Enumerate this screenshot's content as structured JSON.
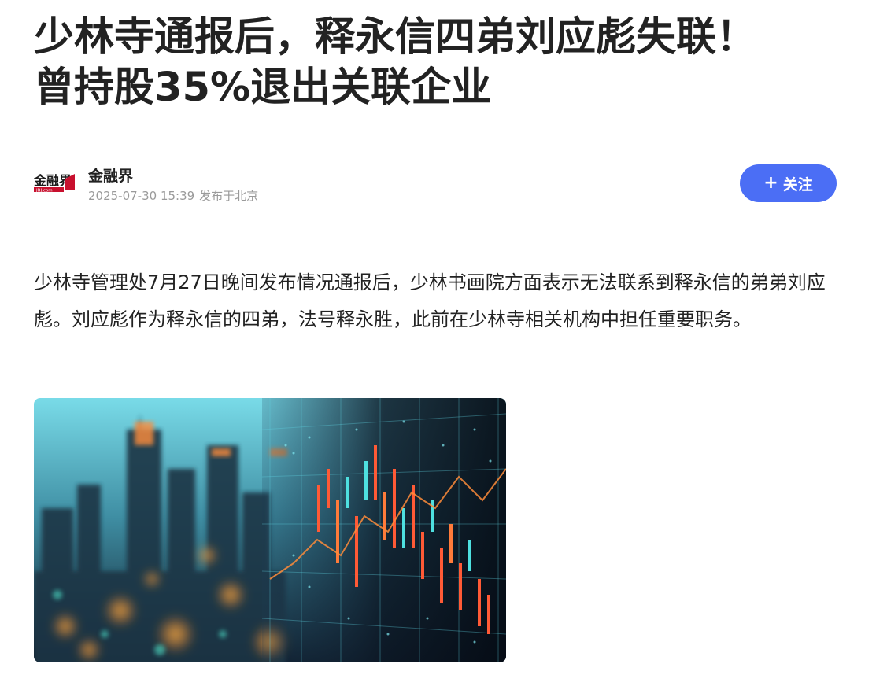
{
  "article": {
    "title_line1": "少林寺通报后，释永信四弟刘应彪失联！",
    "title_line2": "曾持股35%退出关联企业",
    "author": {
      "name": "金融界",
      "logo_text": "金融界",
      "logo_subtext": "JRJ.com",
      "date": "2025-07-30 15:39",
      "location": "发布于北京"
    },
    "follow_button": {
      "icon": "plus-icon",
      "label": "关注",
      "color": "#4b6ef5"
    },
    "body": "少林寺管理处7月27日晚间发布情况通报后，少林书画院方面表示无法联系到释永信的弟弟刘应彪。刘应彪作为释永信的四弟，法号释永胜，此前在少林寺相关机构中担任重要职务。",
    "image": {
      "subject": "blurred city skyline with financial market chart overlay",
      "colors": [
        "#5fd0e0",
        "#1b2a3a",
        "#ff8c2a",
        "#e8402c"
      ]
    }
  }
}
